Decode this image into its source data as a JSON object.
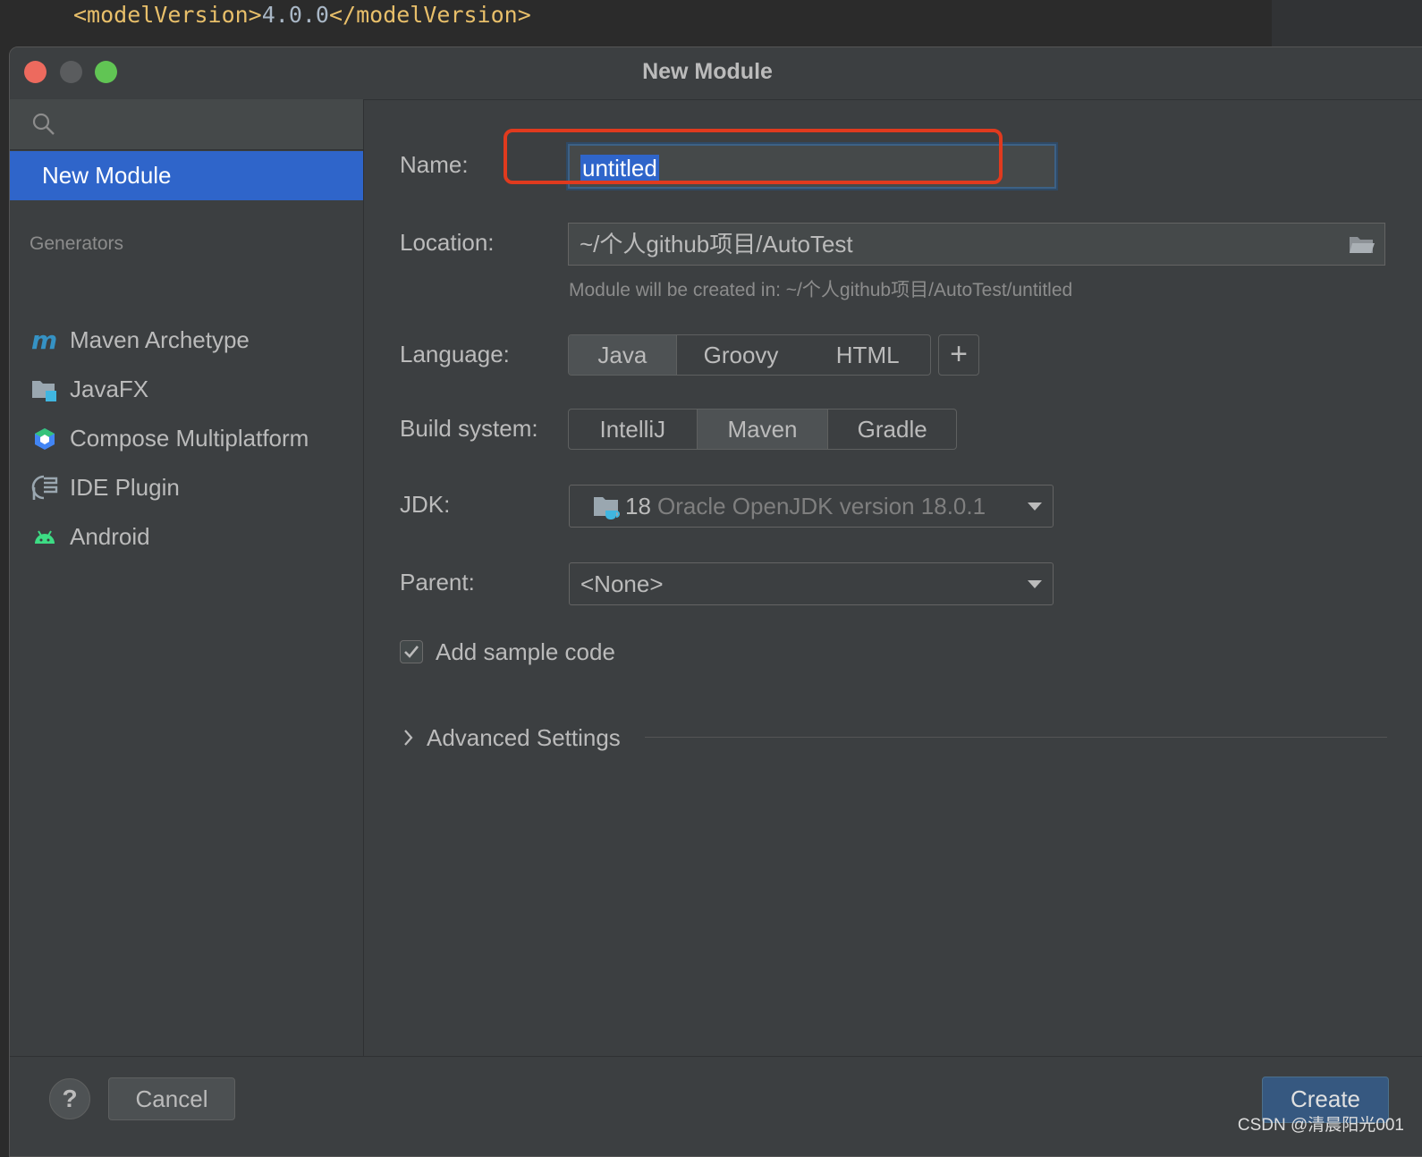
{
  "editor": {
    "code_prefix": "<modelVersion>",
    "code_value": "4.0.0",
    "code_suffix": "</modelVersion>"
  },
  "dialog": {
    "title": "New Module",
    "sidebar": {
      "selected_item": "New Module",
      "generators_header": "Generators",
      "generators": [
        {
          "label": "Maven Archetype",
          "icon": "maven-icon"
        },
        {
          "label": "JavaFX",
          "icon": "javafx-icon"
        },
        {
          "label": "Compose Multiplatform",
          "icon": "compose-icon"
        },
        {
          "label": "IDE Plugin",
          "icon": "plugin-icon"
        },
        {
          "label": "Android",
          "icon": "android-icon"
        }
      ]
    },
    "form": {
      "name_label": "Name:",
      "name_value": "untitled",
      "location_label": "Location:",
      "location_value": "~/个人github项目/AutoTest",
      "location_hint": "Module will be created in: ~/个人github项目/AutoTest/untitled",
      "language_label": "Language:",
      "languages": [
        "Java",
        "Groovy",
        "HTML"
      ],
      "language_selected": "Java",
      "add_language": "+",
      "build_label": "Build system:",
      "build_systems": [
        "IntelliJ",
        "Maven",
        "Gradle"
      ],
      "build_selected": "Maven",
      "jdk_label": "JDK:",
      "jdk_version": "18",
      "jdk_name": "Oracle OpenJDK version 18.0.1",
      "parent_label": "Parent:",
      "parent_value": "<None>",
      "sample_code_label": "Add sample code",
      "sample_code_checked": true,
      "advanced_label": "Advanced Settings"
    },
    "footer": {
      "help": "?",
      "cancel": "Cancel",
      "create": "Create"
    }
  },
  "watermark": "CSDN @清晨阳光001",
  "colors": {
    "accent": "#2f65ca",
    "highlight_box": "#e03a1e",
    "create_button": "#365880"
  }
}
